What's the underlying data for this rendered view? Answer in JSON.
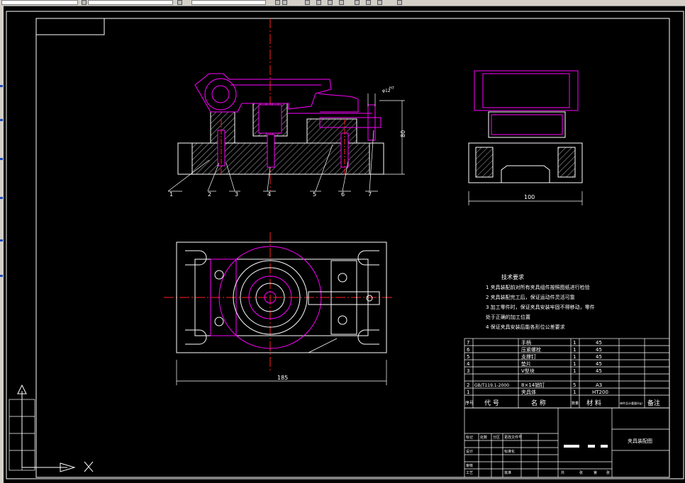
{
  "leaders": [
    "1",
    "2",
    "3",
    "4",
    "5",
    "6",
    "7"
  ],
  "dims": {
    "phi_top": "φ12",
    "phi_sub": "H7",
    "height": "80",
    "side_width": "100",
    "plan_width": "185"
  },
  "tech_req": {
    "title": "技术要求",
    "items": [
      "1  夹具装配前对所有夹具组件按照图纸进行检验",
      "2  夹具装配完工后，保证运动件灵活可靠",
      "3  加工零件时，保证夹具安装牢固不得移动，零件",
      "    处于正确的加工位置",
      "4  保证夹具安装后能各形位公差要求"
    ]
  },
  "bom": {
    "rows": [
      {
        "no": "7",
        "code": "",
        "name": "手柄",
        "qty": "1",
        "mat": "45"
      },
      {
        "no": "6",
        "code": "",
        "name": "压紧螺栓",
        "qty": "1",
        "mat": "45"
      },
      {
        "no": "5",
        "code": "",
        "name": "支撑钉",
        "qty": "1",
        "mat": "45"
      },
      {
        "no": "4",
        "code": "",
        "name": "垫片",
        "qty": "1",
        "mat": "45"
      },
      {
        "no": "3",
        "code": "",
        "name": "V型块",
        "qty": "1",
        "mat": "45"
      },
      {
        "no": "2",
        "code": "GB/T119.1-2000",
        "name": "8×14销钉",
        "qty": "5",
        "mat": "A3"
      },
      {
        "no": "1",
        "code": "",
        "name": "夹具体",
        "qty": "1",
        "mat": "HT200"
      }
    ],
    "header": {
      "no": "序号",
      "code": "代  号",
      "name": "名  称",
      "qty": "数量",
      "mat": "材  料",
      "weight": "单件总计重量(kg)",
      "note": "备注"
    }
  },
  "title_block": {
    "drawing_name": "夹具装配图",
    "labels": [
      "标记",
      "处数",
      "分区",
      "更改文件号",
      "签名",
      "年月日",
      "设计",
      "标准化",
      "审核",
      "工艺",
      "批准",
      "阶段标记",
      "重量",
      "比例",
      "共",
      "张",
      "第",
      "张"
    ]
  },
  "colors": {
    "background": "#000000",
    "lines": "#ffffff",
    "part": "#ff00ff",
    "center": "#ff0000",
    "ucs": "#ffffff"
  }
}
